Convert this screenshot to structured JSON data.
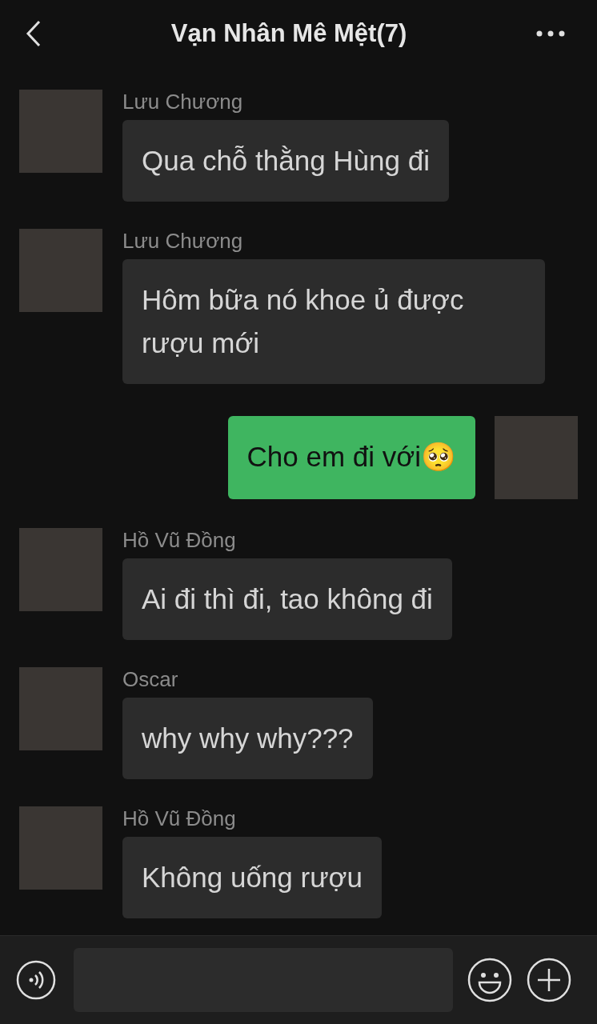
{
  "header": {
    "title": "Vạn Nhân Mê Mệt(7)"
  },
  "messages": [
    {
      "kind": "incoming",
      "sender": "Lưu Chương",
      "text": "Qua chỗ thằng Hùng đi"
    },
    {
      "kind": "incoming",
      "sender": "Lưu Chương",
      "text": "Hôm bữa nó khoe ủ được rượu mới"
    },
    {
      "kind": "outgoing",
      "text": "Cho em đi với🥺"
    },
    {
      "kind": "incoming",
      "sender": "Hồ Vũ Đồng",
      "text": "Ai đi thì đi, tao không đi"
    },
    {
      "kind": "incoming",
      "sender": "Oscar",
      "text": "why why why???"
    },
    {
      "kind": "incoming",
      "sender": "Hồ Vũ Đồng",
      "text": "Không uống rượu"
    }
  ]
}
